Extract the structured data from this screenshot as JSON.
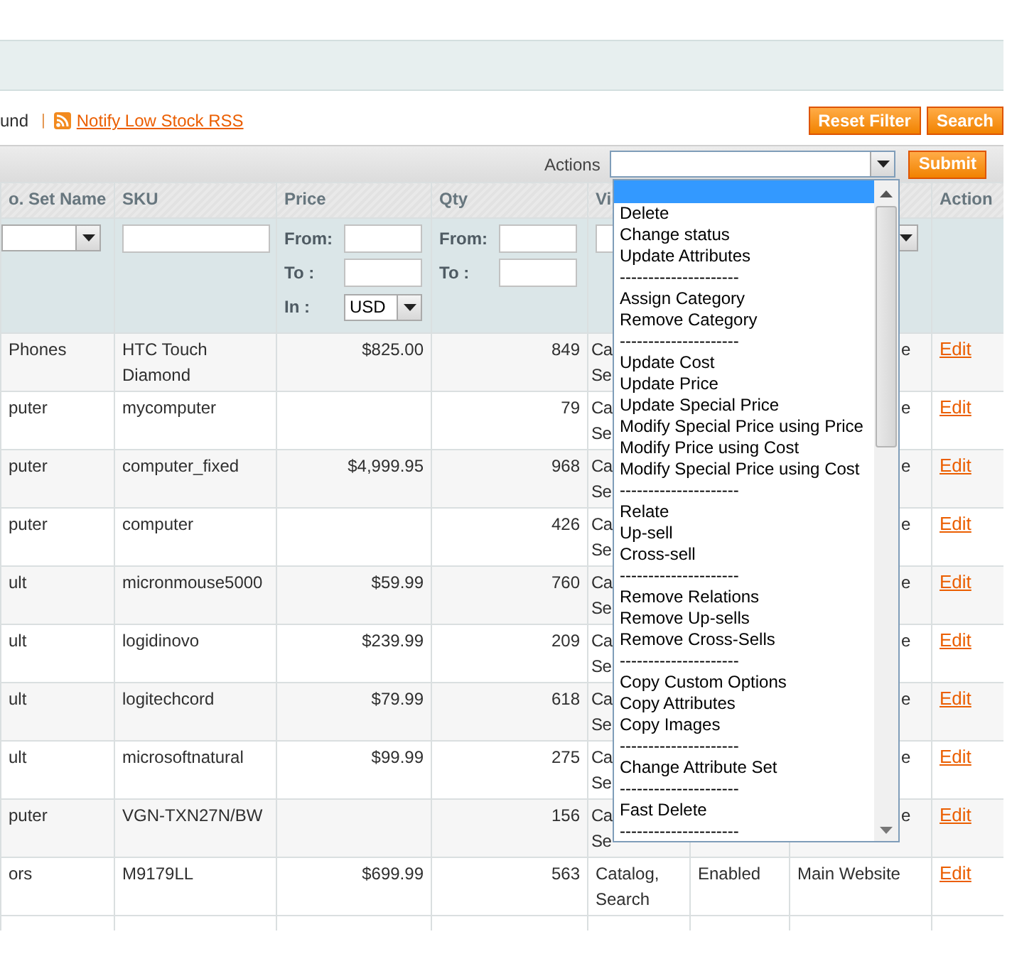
{
  "toolbar": {
    "records_text": "und",
    "separator": "|",
    "rss_link": "Notify Low Stock RSS",
    "buttons": [
      "Reset Filter",
      "Search"
    ]
  },
  "massaction": {
    "label": "Actions",
    "submit": "Submit"
  },
  "actions_menu": {
    "options": [
      {
        "selected": true
      },
      {
        "label": "Delete",
        "selected": false
      },
      {
        "label": "Change status",
        "selected": false
      },
      {
        "label": "Update Attributes",
        "selected": false
      },
      {
        "label": "---------------------",
        "selected": false
      },
      {
        "label": "Assign Category",
        "selected": false
      },
      {
        "label": "Remove Category",
        "selected": false
      },
      {
        "label": "---------------------",
        "selected": false
      },
      {
        "label": "Update Cost",
        "selected": false
      },
      {
        "label": "Update Price",
        "selected": false
      },
      {
        "label": "Update Special Price",
        "selected": false
      },
      {
        "label": "Modify Special Price using Price",
        "selected": false
      },
      {
        "label": "Modify Price using Cost",
        "selected": false
      },
      {
        "label": "Modify Special Price using Cost",
        "selected": false
      },
      {
        "label": "---------------------",
        "selected": false
      },
      {
        "label": "Relate",
        "selected": false
      },
      {
        "label": "Up-sell",
        "selected": false
      },
      {
        "label": "Cross-sell",
        "selected": false
      },
      {
        "label": "---------------------",
        "selected": false
      },
      {
        "label": "Remove Relations",
        "selected": false
      },
      {
        "label": "Remove Up-sells",
        "selected": false
      },
      {
        "label": "Remove Cross-Sells",
        "selected": false
      },
      {
        "label": "---------------------",
        "selected": false
      },
      {
        "label": "Copy Custom Options",
        "selected": false
      },
      {
        "label": "Copy Attributes",
        "selected": false
      },
      {
        "label": "Copy Images",
        "selected": false
      },
      {
        "label": "---------------------",
        "selected": false
      },
      {
        "label": "Change Attribute Set",
        "selected": false
      },
      {
        "label": "---------------------",
        "selected": false
      },
      {
        "label": "Fast Delete",
        "selected": false
      },
      {
        "label": "---------------------",
        "selected": false
      }
    ]
  },
  "table": {
    "columns": [
      "o. Set Name",
      "SKU",
      "Price",
      "Qty",
      "Vi",
      "Action"
    ],
    "price_filter": {
      "from_label": "From:",
      "to_label": "To :",
      "in_label": "In :",
      "currency": "USD"
    },
    "qty_filter": {
      "from_label": "From:",
      "to_label": "To :"
    },
    "rows": [
      {
        "set": "Phones",
        "sku": "HTC Touch Diamond",
        "price": "$825.00",
        "qty": "849",
        "visibility": "Ca Se",
        "websites": "e",
        "action": "Edit"
      },
      {
        "set": "puter",
        "sku": "mycomputer",
        "qty": "79",
        "visibility": "Ca Se",
        "websites": "e",
        "action": "Edit"
      },
      {
        "set": "puter",
        "sku": "computer_fixed",
        "price": "$4,999.95",
        "qty": "968",
        "visibility": "Ca Se",
        "websites": "e",
        "action": "Edit"
      },
      {
        "set": "puter",
        "sku": "computer",
        "qty": "426",
        "visibility": "Ca Se",
        "websites": "e",
        "action": "Edit"
      },
      {
        "set": "ult",
        "sku": "micronmouse5000",
        "price": "$59.99",
        "qty": "760",
        "visibility": "Ca Se",
        "websites": "e",
        "action": "Edit"
      },
      {
        "set": "ult",
        "sku": "logidinovo",
        "price": "$239.99",
        "qty": "209",
        "visibility": "Ca Se",
        "websites": "e",
        "action": "Edit"
      },
      {
        "set": "ult",
        "sku": "logitechcord",
        "price": "$79.99",
        "qty": "618",
        "visibility": "Ca Se",
        "websites": "e",
        "action": "Edit"
      },
      {
        "set": "ult",
        "sku": "microsoftnatural",
        "price": "$99.99",
        "qty": "275",
        "visibility": "Ca Se",
        "websites": "e",
        "action": "Edit"
      },
      {
        "set": "puter",
        "sku": "VGN-TXN27N/BW",
        "qty": "156",
        "visibility": "Ca Se",
        "websites": "e",
        "action": "Edit"
      },
      {
        "set": "ors",
        "sku": "M9179LL",
        "price": "$699.99",
        "qty": "563",
        "visibility": "Catalog, Search",
        "status": "Enabled",
        "websites": "Main Website",
        "action": "Edit"
      }
    ]
  }
}
